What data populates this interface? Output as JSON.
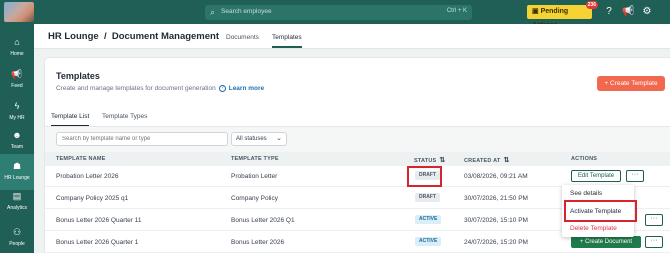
{
  "topbar": {
    "search_placeholder": "Search employee",
    "search_shortcut": "Ctrl + K",
    "pending_label": "Pending Actions",
    "pending_count": "236",
    "icons": [
      "help-icon",
      "megaphone-icon",
      "settings-icon"
    ]
  },
  "sidebar": {
    "items": [
      {
        "label": "Home",
        "icon": "home-icon"
      },
      {
        "label": "Feed",
        "icon": "megaphone-icon"
      },
      {
        "label": "My HR",
        "icon": "lightning-icon"
      },
      {
        "label": "Team",
        "icon": "team-icon"
      },
      {
        "label": "HR Lounge",
        "icon": "hr-lounge-icon"
      },
      {
        "label": "Analytics",
        "icon": "analytics-icon"
      },
      {
        "label": "People",
        "icon": "org-chart-icon"
      }
    ]
  },
  "header": {
    "breadcrumb": "HR Lounge  /  Document Management",
    "tabs": [
      "Documents",
      "Templates"
    ]
  },
  "page": {
    "title": "Templates",
    "subtitle": "Create and manage templates for document generation",
    "learn_more": "Learn more",
    "create_button": "+ Create Template",
    "sub_tabs": [
      "Template List",
      "Template Types"
    ]
  },
  "filters": {
    "search_placeholder": "Search by template name or type",
    "status_value": "All statuses"
  },
  "table": {
    "columns": [
      "TEMPLATE NAME",
      "TEMPLATE TYPE",
      "STATUS",
      "CREATED AT",
      "ACTIONS"
    ],
    "rows": [
      {
        "name": "Probation Letter 2026",
        "type": "Probation Letter",
        "status": "DRAFT",
        "created": "03/08/2026, 09:21 AM"
      },
      {
        "name": "Company Policy 2025 q1",
        "type": "Company Policy",
        "status": "DRAFT",
        "created": "30/07/2026, 21:50 PM"
      },
      {
        "name": "Bonus Letter 2026 Quarter 11",
        "type": "Bonus Letter 2026 Q1",
        "status": "ACTIVE",
        "created": "30/07/2026, 15:10 PM"
      },
      {
        "name": "Bonus Letter 2026 Quarter 1",
        "type": "Bonus Letter 2026",
        "status": "ACTIVE",
        "created": "24/07/2026, 15:20 PM"
      }
    ],
    "edit_label": "Edit Template",
    "more_label": "···",
    "create_doc_label": "+ Create Document"
  },
  "menu": {
    "items": [
      "See details",
      "Activate Template",
      "Delete Template"
    ]
  },
  "colors": {
    "brand": "#1f5f55",
    "accent_orange": "#f2684e",
    "pending_yellow": "#f5d334",
    "highlight_red": "#d7262b",
    "create_doc_green": "#1f7a4c"
  }
}
